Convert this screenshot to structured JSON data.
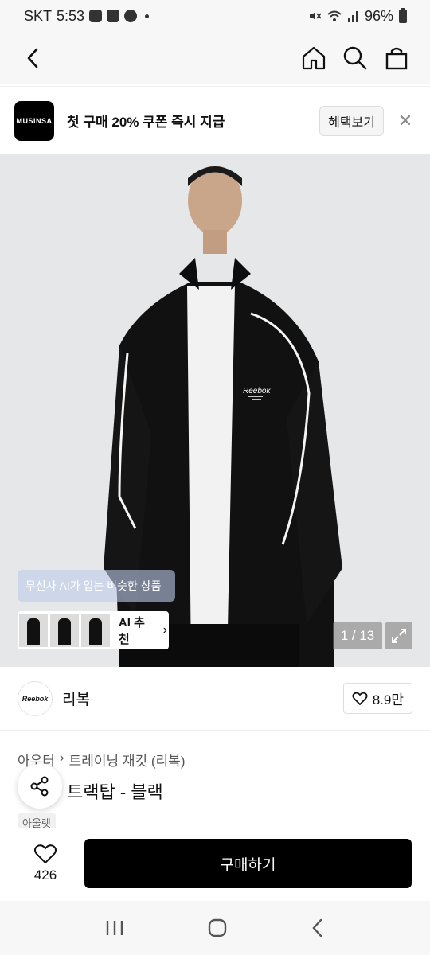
{
  "status_bar": {
    "carrier": "SKT",
    "time": "5:53",
    "battery": "96%"
  },
  "promo": {
    "logo_text": "MUSINSA",
    "text": "첫 구매 20% 쿠폰 즉시 지급",
    "button_label": "혜택보기"
  },
  "gallery": {
    "ai_banner": "무신사 AI가 입는 비슷한 상품",
    "ai_recommend_label": "AI 추천",
    "counter": "1 / 13",
    "image_position": 1,
    "image_total": 13
  },
  "brand": {
    "logo_text": "Reebok",
    "name": "리복",
    "likes": "8.9만"
  },
  "product": {
    "breadcrumb": [
      "아우터",
      "트레이닝 재킷 (리복)"
    ],
    "title": "트랙탑 - 블랙",
    "tag": "아울렛"
  },
  "bottom_bar": {
    "wish_count": "426",
    "buy_label": "구매하기"
  },
  "colors": {
    "accent": "#000000",
    "background": "#f7f7f7"
  }
}
